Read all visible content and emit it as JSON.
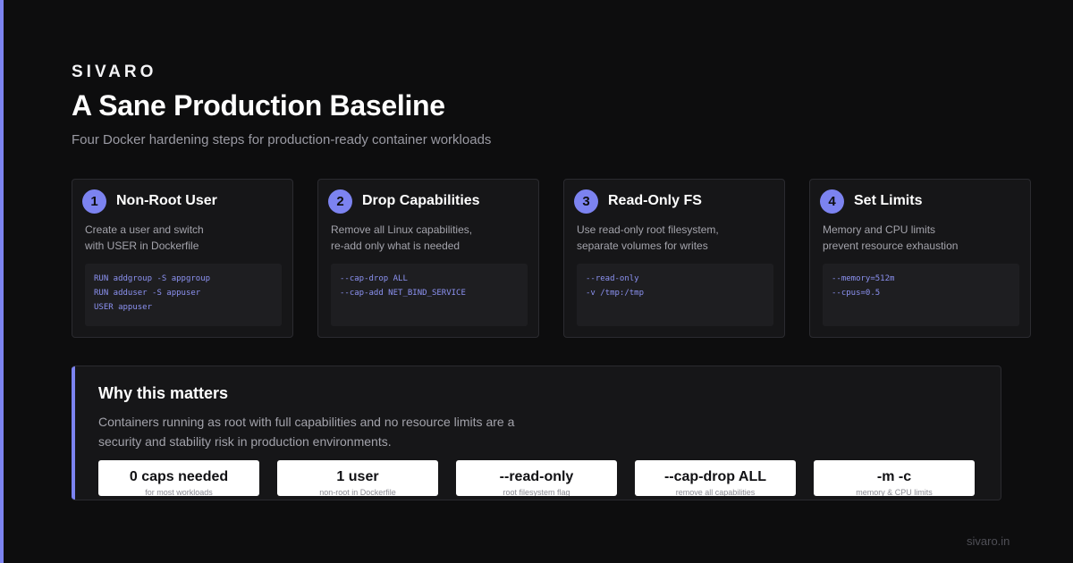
{
  "brand": "SIVARO",
  "title": "A Sane Production Baseline",
  "subtitle": "Four Docker hardening steps for production-ready container workloads",
  "cards": [
    {
      "num": "1",
      "title": "Non-Root User",
      "desc": [
        "Create a user and switch",
        "with USER in Dockerfile"
      ],
      "code": [
        "RUN addgroup -S appgroup",
        "RUN adduser -S appuser",
        "USER appuser"
      ]
    },
    {
      "num": "2",
      "title": "Drop Capabilities",
      "desc": [
        "Remove all Linux capabilities,",
        "re-add only what is needed"
      ],
      "code": [
        "--cap-drop ALL",
        "--cap-add NET_BIND_SERVICE"
      ]
    },
    {
      "num": "3",
      "title": "Read-Only FS",
      "desc": [
        "Use read-only root filesystem,",
        "separate volumes for writes"
      ],
      "code": [
        "--read-only",
        "-v /tmp:/tmp"
      ]
    },
    {
      "num": "4",
      "title": "Set Limits",
      "desc": [
        "Memory and CPU limits",
        "prevent resource exhaustion"
      ],
      "code": [
        "--memory=512m",
        "--cpus=0.5"
      ]
    }
  ],
  "why": {
    "title": "Why this matters",
    "text": [
      "Containers running as root with full capabilities and no resource limits are a",
      "security and stability risk in production environments."
    ],
    "stats": [
      {
        "value": "0 caps needed",
        "label": "for most workloads"
      },
      {
        "value": "1 user",
        "label": "non-root in Dockerfile"
      },
      {
        "value": "--read-only",
        "label": "root filesystem flag"
      },
      {
        "value": "--cap-drop ALL",
        "label": "remove all capabilities"
      },
      {
        "value": "-m -c",
        "label": "memory & CPU limits"
      }
    ]
  },
  "footer": "sivaro.in",
  "colors": {
    "accent": "#7c83f0",
    "background": "#0d0d0e",
    "card": "#161618"
  }
}
